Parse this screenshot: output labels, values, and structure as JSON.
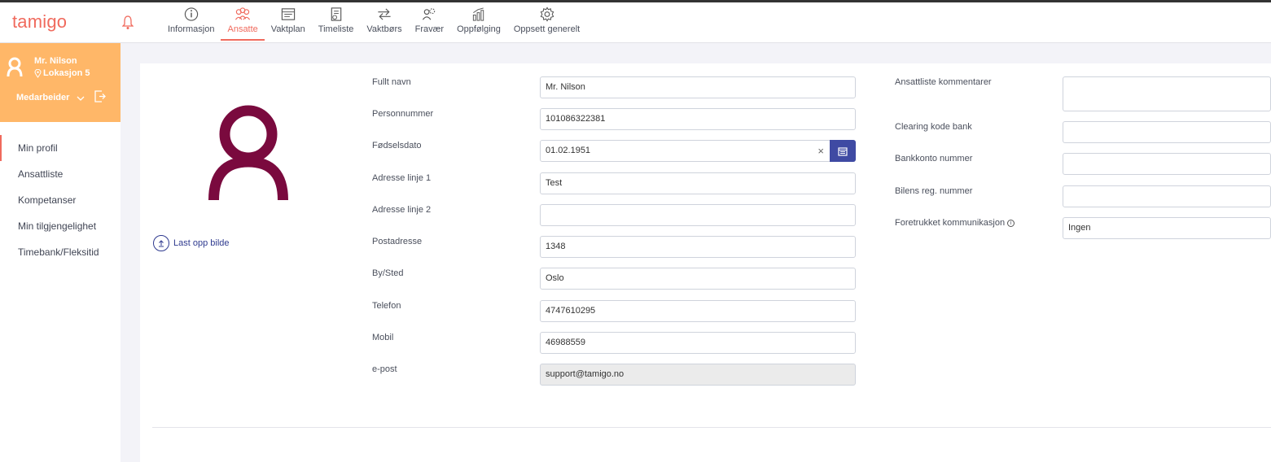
{
  "app": {
    "logo": "tamigo"
  },
  "nav": [
    {
      "label": "Informasjon",
      "icon": "info-icon"
    },
    {
      "label": "Ansatte",
      "icon": "people-icon",
      "active": true
    },
    {
      "label": "Vaktplan",
      "icon": "schedule-icon"
    },
    {
      "label": "Timeliste",
      "icon": "timesheet-icon"
    },
    {
      "label": "Vaktbørs",
      "icon": "exchange-icon"
    },
    {
      "label": "Fravær",
      "icon": "absence-icon"
    },
    {
      "label": "Oppfølging",
      "icon": "chart-icon"
    },
    {
      "label": "Oppsett generelt",
      "icon": "gear-icon"
    }
  ],
  "user": {
    "name": "Mr. Nilson",
    "location": "Lokasjon 5",
    "role": "Medarbeider"
  },
  "sidebar": {
    "items": [
      {
        "label": "Min profil",
        "active": true
      },
      {
        "label": "Ansattliste"
      },
      {
        "label": "Kompetanser"
      },
      {
        "label": "Min tilgjengelighet"
      },
      {
        "label": "Timebank/Fleksitid"
      }
    ]
  },
  "profile": {
    "upload_label": "Last opp bilde",
    "avatar_color": "#7a0a3e",
    "fields": {
      "full_name": {
        "label": "Fullt navn",
        "value": "Mr. Nilson"
      },
      "personal_number": {
        "label": "Personnummer",
        "value": "10108632238​1"
      },
      "birth_date": {
        "label": "Fødselsdato",
        "value": "01.02.1951"
      },
      "address1": {
        "label": "Adresse linje 1",
        "value": "Test"
      },
      "address2": {
        "label": "Adresse linje 2",
        "value": ""
      },
      "postal": {
        "label": "Postadresse",
        "value": "1348"
      },
      "city": {
        "label": "By/Sted",
        "value": "Oslo"
      },
      "phone": {
        "label": "Telefon",
        "value": "4747610295"
      },
      "mobile": {
        "label": "Mobil",
        "value": "46988559"
      },
      "email": {
        "label": "e-post",
        "value": "support@tamigo.no"
      }
    },
    "right_fields": {
      "comments": {
        "label": "Ansattliste kommentarer",
        "value": ""
      },
      "clearing": {
        "label": "Clearing kode bank",
        "value": ""
      },
      "account": {
        "label": "Bankkonto nummer",
        "value": ""
      },
      "car_reg": {
        "label": "Bilens reg. nummer",
        "value": ""
      },
      "comm_pref": {
        "label": "Foretrukket kommunikasjon",
        "value": "Ingen"
      }
    }
  },
  "colors": {
    "accent": "#f06a5d",
    "user_card": "#ffb768",
    "primary_button": "#3f4aa3"
  }
}
